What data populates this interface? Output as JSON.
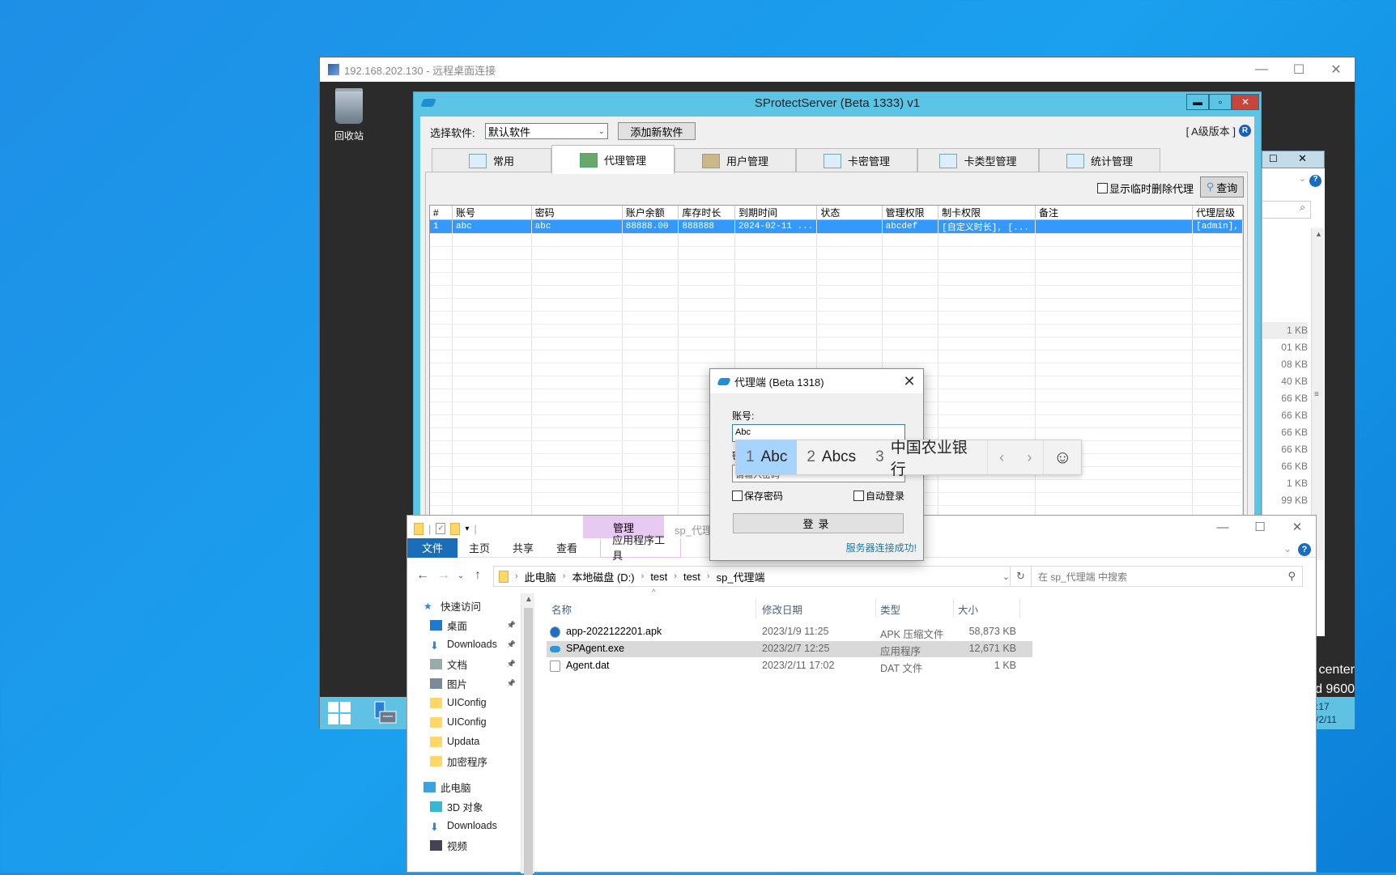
{
  "rdp": {
    "title": "192.168.202.130 - 远程桌面连接",
    "desktop_icon": "回收站",
    "watermark_line1": "center",
    "watermark_line2": "d 9600",
    "clock_time": ":17",
    "clock_date": "/2/11"
  },
  "sprotect": {
    "title": "SProtectServer (Beta 1333) v1",
    "select_label": "选择软件:",
    "select_value": "默认软件",
    "add_button": "添加新软件",
    "version": "[ A级版本 ]",
    "version_badge": "R",
    "tabs": [
      {
        "label": "常用",
        "icon": "dashboard-icon"
      },
      {
        "label": "代理管理",
        "icon": "agents-icon",
        "active": true
      },
      {
        "label": "用户管理",
        "icon": "users-icon"
      },
      {
        "label": "卡密管理",
        "icon": "checklist-icon"
      },
      {
        "label": "卡类型管理",
        "icon": "list-icon"
      },
      {
        "label": "统计管理",
        "icon": "stats-icon"
      }
    ],
    "show_deleted_label": "显示临时删除代理",
    "query_button": "查询",
    "columns": [
      "#",
      "账号",
      "密码",
      "账户余额",
      "库存时长",
      "到期时间",
      "状态",
      "管理权限",
      "制卡权限",
      "备注",
      "代理层级"
    ],
    "rows": [
      [
        "1",
        "abc",
        "abc",
        "88888.00",
        "888888",
        "2024-02-11 ...",
        "",
        "abcdef",
        "[自定义时长], [...",
        "",
        "[admin],"
      ]
    ]
  },
  "login": {
    "title": "代理端 (Beta 1318)",
    "account_label": "账号:",
    "account_value": "Abc",
    "password_label": "密",
    "password_value": "请输入密码",
    "save_password": "保存密码",
    "auto_login": "自动登录",
    "login_button": "登录",
    "status": "服务器连接成功!"
  },
  "ime": {
    "candidates": [
      {
        "num": "1",
        "text": "Abc",
        "selected": true
      },
      {
        "num": "2",
        "text": "Abcs"
      },
      {
        "num": "3",
        "text": "中国农业银行"
      }
    ],
    "prev": "‹",
    "next": "›",
    "emoji": "☺"
  },
  "explorer": {
    "window_title": "sp_代理",
    "manage_tab": "管理",
    "ribbon_tabs": [
      "文件",
      "主页",
      "共享",
      "查看"
    ],
    "app_tools_tab": "应用程序工具",
    "breadcrumb": [
      "此电脑",
      "本地磁盘 (D:)",
      "test",
      "test",
      "sp_代理端"
    ],
    "search_placeholder": "在 sp_代理端 中搜索",
    "nav_items": [
      {
        "label": "快速访问",
        "icon": "star-icon",
        "level": 0
      },
      {
        "label": "桌面",
        "icon": "desktop-icon",
        "pinned": true
      },
      {
        "label": "Downloads",
        "icon": "download-icon",
        "pinned": true
      },
      {
        "label": "文档",
        "icon": "document-icon",
        "pinned": true
      },
      {
        "label": "图片",
        "icon": "picture-icon",
        "pinned": true
      },
      {
        "label": "UIConfig",
        "icon": "folder-icon"
      },
      {
        "label": "UIConfig",
        "icon": "folder-icon"
      },
      {
        "label": "Updata",
        "icon": "folder-icon"
      },
      {
        "label": "加密程序",
        "icon": "folder-icon"
      },
      {
        "label": "此电脑",
        "icon": "computer-icon",
        "level": 0
      },
      {
        "label": "3D 对象",
        "icon": "cube-icon"
      },
      {
        "label": "Downloads",
        "icon": "download-icon"
      },
      {
        "label": "视频",
        "icon": "video-icon"
      }
    ],
    "columns": [
      "名称",
      "修改日期",
      "类型",
      "大小"
    ],
    "files": [
      {
        "name": "app-2022122201.apk",
        "date": "2023/1/9 11:25",
        "type": "APK 压缩文件",
        "size": "58,873 KB",
        "icon": "apk-icon"
      },
      {
        "name": "SPAgent.exe",
        "date": "2023/2/7 12:25",
        "type": "应用程序",
        "size": "12,671 KB",
        "icon": "app-icon",
        "selected": true
      },
      {
        "name": "Agent.dat",
        "date": "2023/2/11 17:02",
        "type": "DAT 文件",
        "size": "1 KB",
        "icon": "file-icon"
      }
    ]
  },
  "bg_explorer": {
    "sizes": [
      "1 KB",
      "01 KB",
      "08 KB",
      "40 KB",
      "66 KB",
      "66 KB",
      "66 KB",
      "66 KB",
      "66 KB",
      "1 KB",
      "99 KB"
    ]
  }
}
